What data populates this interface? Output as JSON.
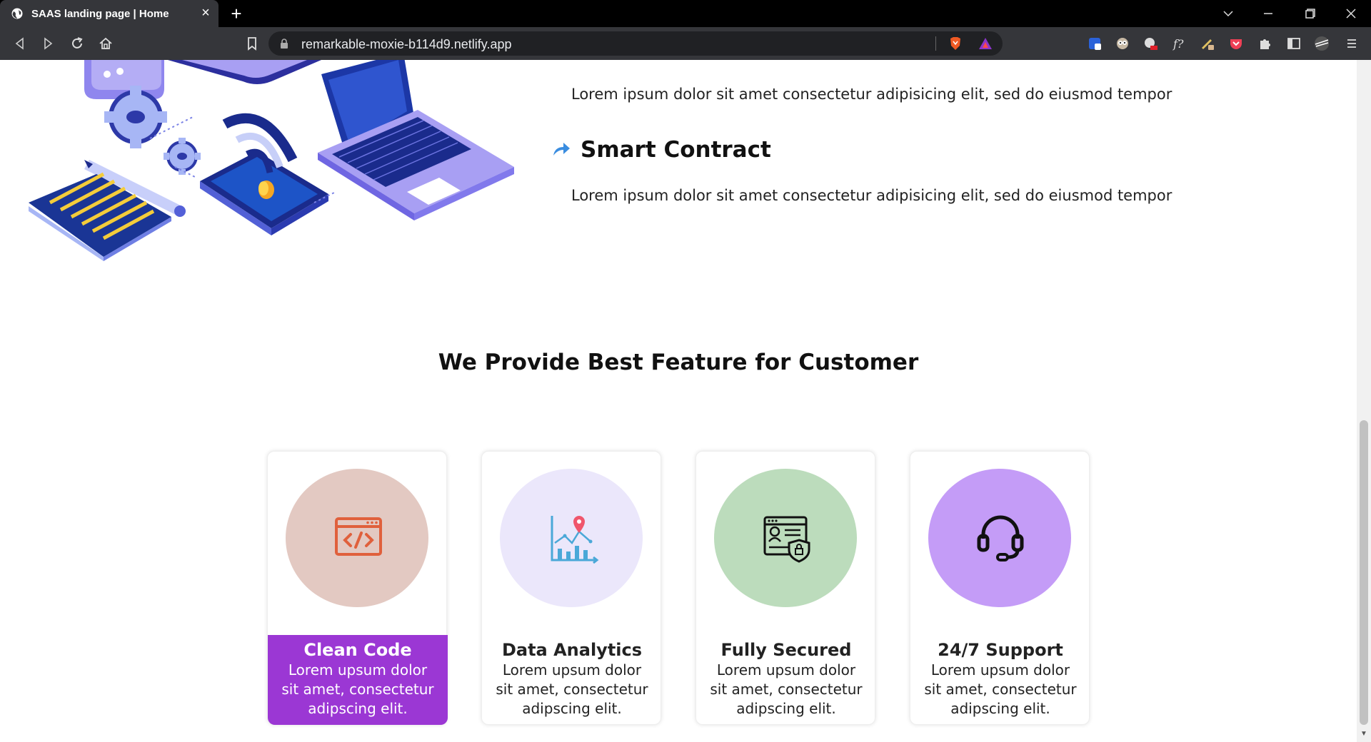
{
  "browser": {
    "tab_title": "SAAS landing page | Home",
    "url": "remarkable-moxie-b114d9.netlify.app"
  },
  "features_list": [
    {
      "description": "Lorem ipsum dolor sit amet consectetur adipisicing elit, sed do eiusmod tempor"
    },
    {
      "title": "Smart Contract",
      "description": "Lorem ipsum dolor sit amet consectetur adipisicing elit, sed do eiusmod tempor"
    }
  ],
  "section_title": "We Provide Best Feature for Customer",
  "cards": [
    {
      "title": "Clean Code",
      "text": "Lorem upsum dolor sit amet, consectetur adipscing elit.",
      "circle_color": "#e3c9c2",
      "icon": "code-window-icon",
      "active": true
    },
    {
      "title": "Data Analytics",
      "text": "Lorem upsum dolor sit amet, consectetur adipscing elit.",
      "circle_color": "#ebe7fb",
      "icon": "analytics-chart-icon",
      "active": false
    },
    {
      "title": "Fully Secured",
      "text": "Lorem upsum dolor sit amet, consectetur adipscing elit.",
      "circle_color": "#bcdcbc",
      "icon": "secure-profile-icon",
      "active": false
    },
    {
      "title": "24/7 Support",
      "text": "Lorem upsum dolor sit amet, consectetur adipscing elit.",
      "circle_color": "#c49cf7",
      "icon": "headset-icon",
      "active": false
    }
  ],
  "colors": {
    "active_card": "#9b37d4",
    "arrow_accent": "#3a8de0"
  }
}
